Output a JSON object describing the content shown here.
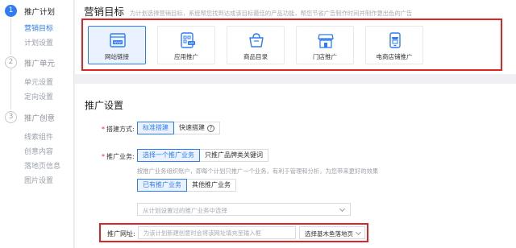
{
  "sidebar": {
    "steps": [
      {
        "number": "1",
        "title": "推广计划",
        "items": [
          "营销目标",
          "计划设置"
        ]
      },
      {
        "number": "2",
        "title": "推广单元",
        "items": [
          "单元设置",
          "定向设置"
        ]
      },
      {
        "number": "3",
        "title": "推广创意",
        "items": [
          "线索组件",
          "创意内容",
          "落地页信息",
          "图片设置"
        ]
      }
    ]
  },
  "goal": {
    "title": "营销目标",
    "description": "为计划选择营销目标，系统帮您找到达成该目标最佳的产品功能，帮您节省广告制作时间并制作更出色的广告",
    "cards": [
      {
        "label": "网站链接",
        "icon": "website-icon",
        "selected": true
      },
      {
        "label": "应用推广",
        "icon": "app-icon",
        "selected": false
      },
      {
        "label": "商品目录",
        "icon": "shopping-basket-icon",
        "selected": false
      },
      {
        "label": "门店推广",
        "icon": "store-icon",
        "selected": false
      },
      {
        "label": "电商店铺推广",
        "icon": "ecommerce-store-icon",
        "selected": false
      }
    ]
  },
  "settings": {
    "title": "推广设置",
    "build_mode": {
      "label": "搭建方式:",
      "options": [
        "标准搭建",
        "快速搭建"
      ]
    },
    "business": {
      "label": "推广业务:",
      "options": [
        "选择一个推广业务",
        "只推广品牌类关键词"
      ],
      "hint": "按推广业务组织账户，即每个计划只推广一个业务，有利于管理和分析，为您带来更好的效果",
      "sub_options": [
        "已有推广业务",
        "其他推广业务"
      ],
      "select_placeholder": "从计划设置过的推广业务中选择"
    },
    "url": {
      "label": "推广网址:",
      "placeholder": "为该计划新建创意时会将该网址填充至输入框",
      "landing_select": "选择基木鱼落地页"
    }
  },
  "colors": {
    "accent": "#2f7cf6",
    "highlight_border": "#e02424"
  }
}
